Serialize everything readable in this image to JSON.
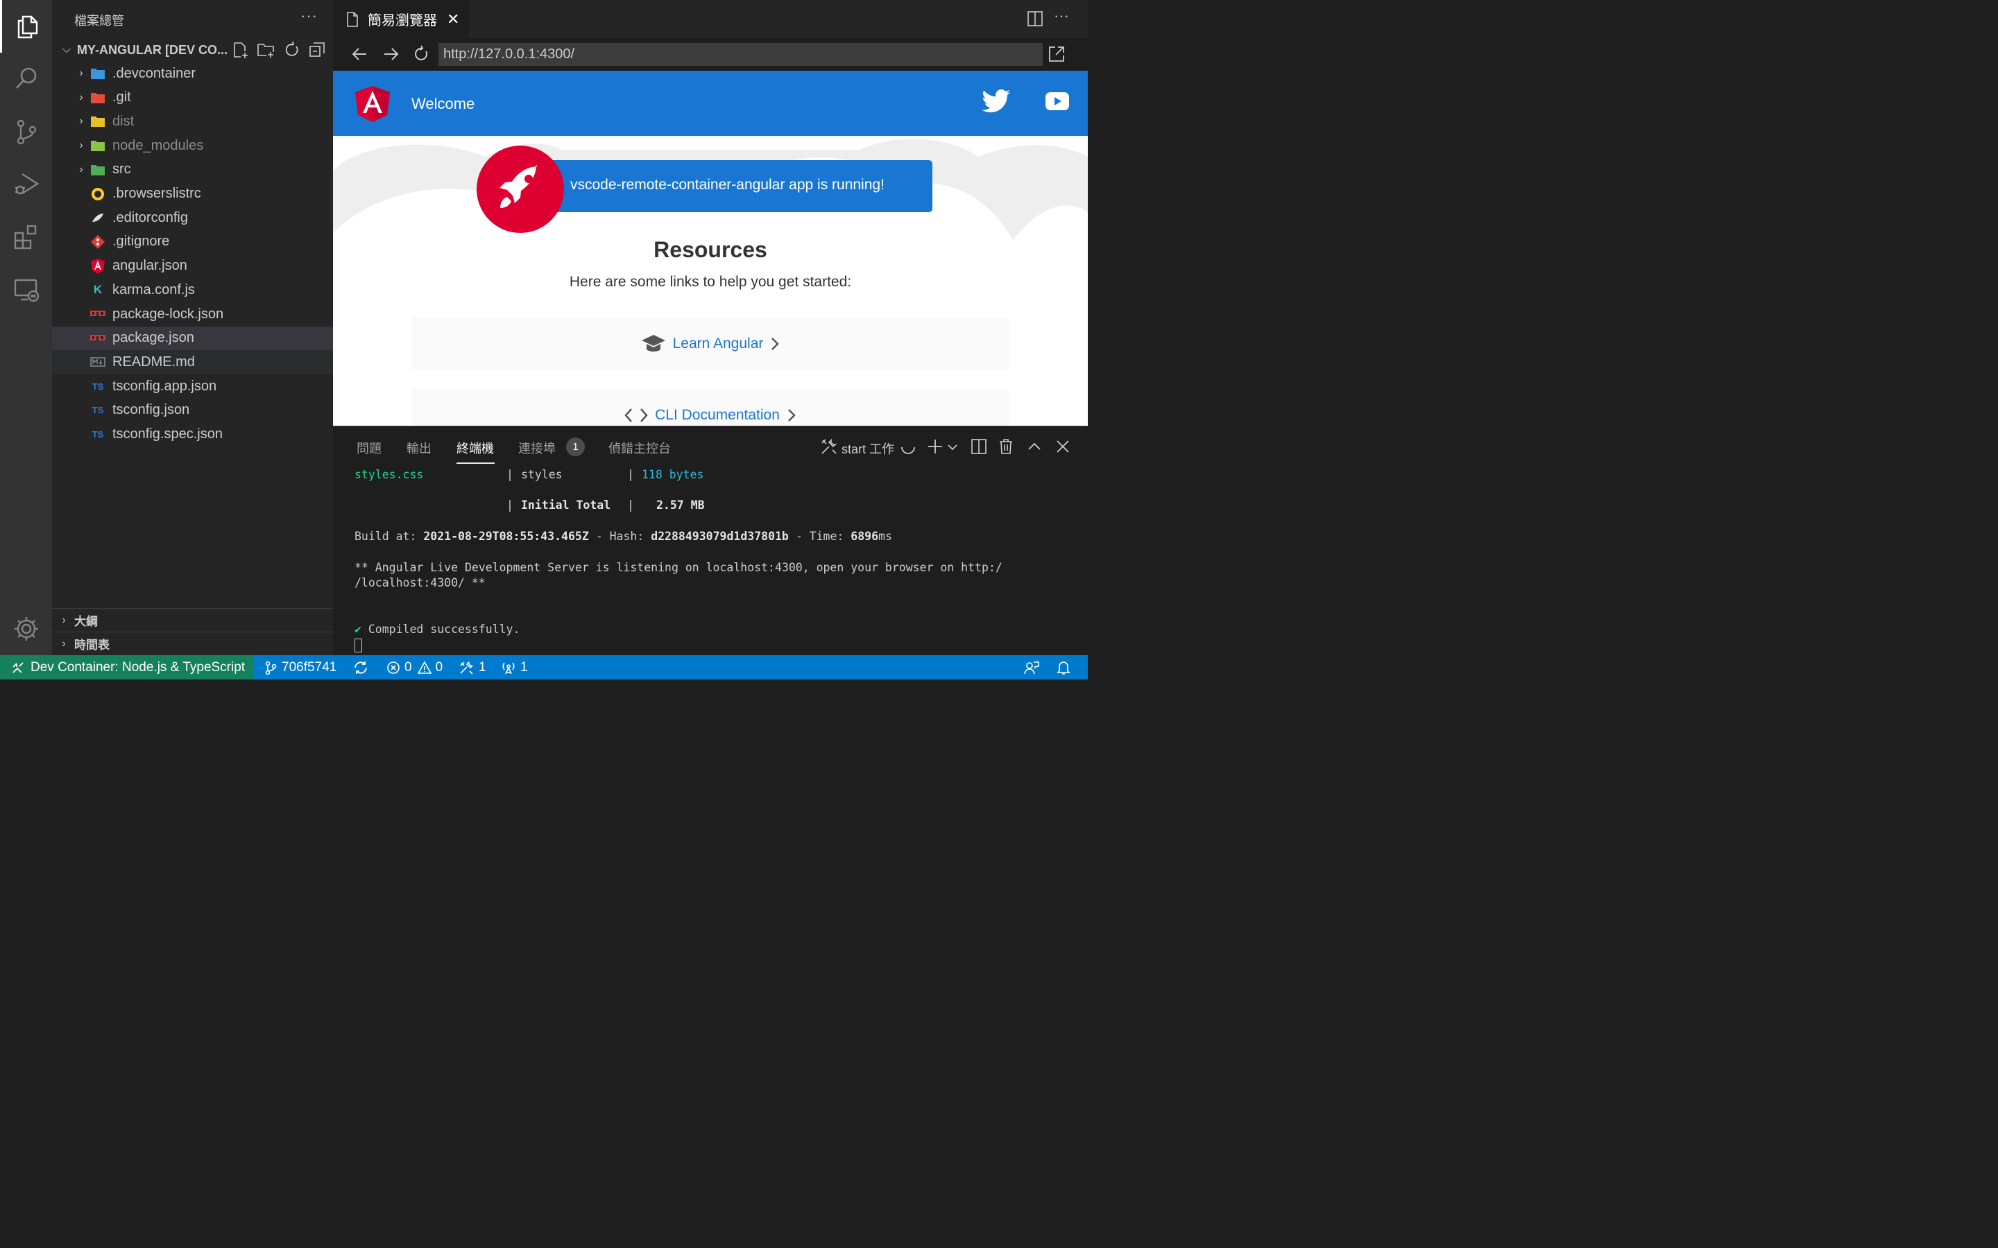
{
  "sidebar": {
    "title": "檔案總管",
    "more": "···",
    "workspace": "MY-ANGULAR [DEV CO...",
    "tree": [
      {
        "name": ".devcontainer",
        "folder": true,
        "icon": "devcontainer-folder-icon",
        "color": "#3a96dd"
      },
      {
        "name": ".git",
        "folder": true,
        "icon": "git-folder-icon",
        "color": "#e64c3c"
      },
      {
        "name": "dist",
        "folder": true,
        "icon": "dist-folder-icon",
        "color": "#e6c229",
        "dim": true
      },
      {
        "name": "node_modules",
        "folder": true,
        "icon": "node-modules-folder-icon",
        "color": "#8bc34a",
        "dim": true
      },
      {
        "name": "src",
        "folder": true,
        "icon": "src-folder-icon",
        "color": "#4caf50"
      },
      {
        "name": ".browserslistrc",
        "folder": false,
        "icon": "browserslist-icon",
        "color": "#ffca28"
      },
      {
        "name": ".editorconfig",
        "folder": false,
        "icon": "editorconfig-icon",
        "color": "#e0e0e0"
      },
      {
        "name": ".gitignore",
        "folder": false,
        "icon": "git-icon",
        "color": "#e53935"
      },
      {
        "name": "angular.json",
        "folder": false,
        "icon": "angular-icon",
        "color": "#dd0031"
      },
      {
        "name": "karma.conf.js",
        "folder": false,
        "icon": "karma-icon",
        "color": "#3cbeae"
      },
      {
        "name": "package-lock.json",
        "folder": false,
        "icon": "npm-icon",
        "color": "#cb3837"
      },
      {
        "name": "package.json",
        "folder": false,
        "icon": "npm-icon",
        "color": "#cb3837"
      },
      {
        "name": "README.md",
        "folder": false,
        "icon": "markdown-icon",
        "color": "#8b8b8b"
      },
      {
        "name": "tsconfig.app.json",
        "folder": false,
        "icon": "tsconfig-icon",
        "color": "#3178c6"
      },
      {
        "name": "tsconfig.json",
        "folder": false,
        "icon": "tsconfig-icon",
        "color": "#3178c6"
      },
      {
        "name": "tsconfig.spec.json",
        "folder": false,
        "icon": "tsconfig-icon",
        "color": "#3178c6"
      }
    ],
    "outline": "大綱",
    "timeline": "時間表"
  },
  "editor": {
    "tab_label": "簡易瀏覽器",
    "url": "http://127.0.0.1:4300/"
  },
  "webpage": {
    "welcome": "Welcome",
    "running": "vscode-remote-container-angular app is running!",
    "resources_title": "Resources",
    "resources_sub": "Here are some links to help you get started:",
    "link1": "Learn Angular",
    "link2": "CLI Documentation",
    "brand_blue": "#1976d2",
    "angular_red": "#dd0031"
  },
  "panel": {
    "tabs": [
      "問題",
      "輸出",
      "終端機",
      "連接埠",
      "偵錯主控台"
    ],
    "active_tab": "終端機",
    "ports_count": "1",
    "task": "start 工作",
    "terminal": {
      "l1_file": "styles.css",
      "l1_sep1": "|",
      "l1_name": "styles",
      "l1_sep2": "|",
      "l1_size": "118 bytes",
      "l2_sep1": "|",
      "l2_label": "Initial Total",
      "l2_sep2": "|",
      "l2_size": "2.57 MB",
      "build_label": "Build at:",
      "build_time": "2021-08-29T08:55:43.465Z",
      "hash_label": "- Hash:",
      "hash": "d2288493079d1d37801b",
      "time_label": "- Time:",
      "time_value": "6896",
      "time_unit": "ms",
      "listen_1": "** Angular Live Development Server is listening on localhost:4300, open your browser on http:/",
      "listen_2": "/localhost:4300/ **",
      "check": "✔",
      "compiled": "Compiled successfully."
    }
  },
  "statusbar": {
    "remote": "Dev Container: Node.js & TypeScript",
    "branch": "706f5741",
    "errors": "0",
    "warnings": "0",
    "tasks": "1",
    "ports": "1"
  }
}
